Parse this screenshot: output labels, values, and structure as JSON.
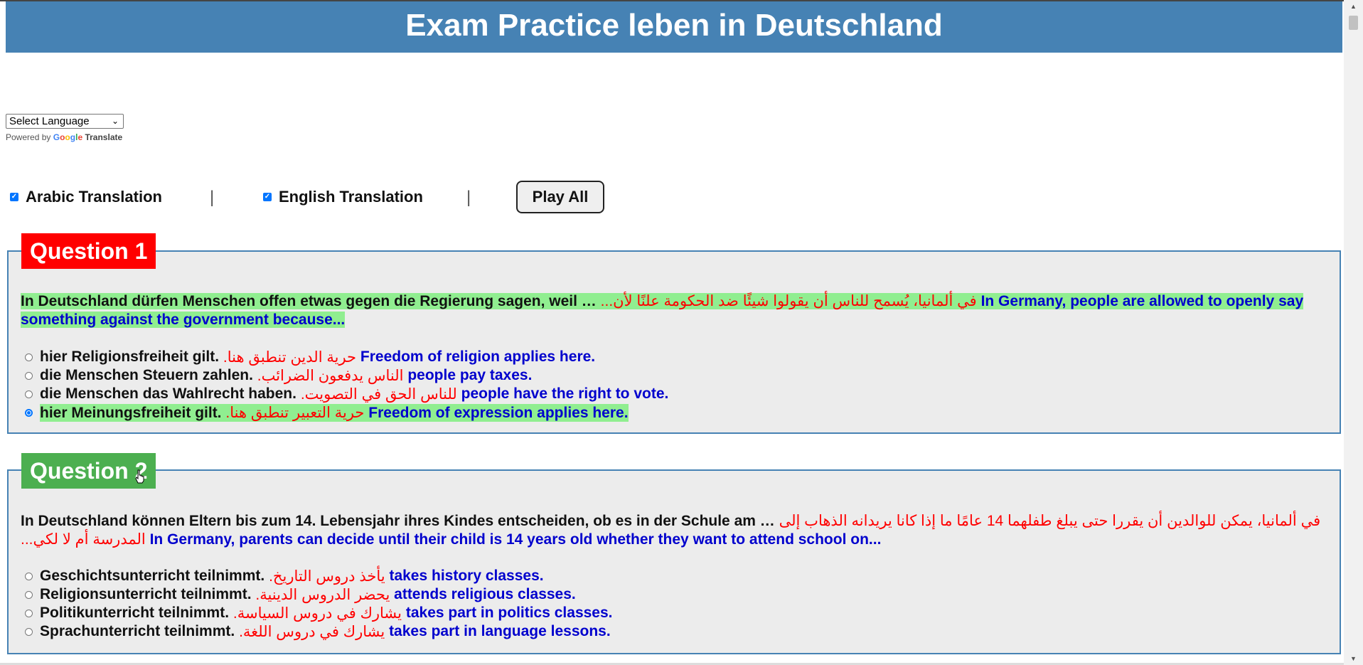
{
  "header": {
    "title": "Exam Practice leben in Deutschland"
  },
  "language": {
    "selected": "Select Language",
    "powered_by": "Powered by",
    "google": [
      "G",
      "o",
      "o",
      "g",
      "l",
      "e"
    ],
    "translate": "Translate"
  },
  "toggles": {
    "arabic": {
      "label": "Arabic Translation",
      "checked": true
    },
    "english": {
      "label": "English Translation",
      "checked": true
    },
    "separator": "|",
    "play_all": "Play All"
  },
  "colors": {
    "header": "#4682b4",
    "question_1_badge": "#ff0000",
    "question_2_badge": "#4caf50",
    "highlight": "#90ee90",
    "arabic": "#ff0000",
    "english": "#0000cd"
  },
  "questions": [
    {
      "label": "Question 1",
      "de": "In Deutschland dürfen Menschen offen etwas gegen die Regierung sagen, weil …",
      "ar": "في ألمانيا، يُسمح للناس أن يقولوا شيئًا ضد الحكومة علنًا لأن...",
      "en": "In Germany, people are allowed to openly say something against the government because...",
      "options": [
        {
          "de": "hier Religionsfreiheit gilt.",
          "ar": "حرية الدين تنطبق هنا.",
          "en": "Freedom of religion applies here.",
          "selected": false
        },
        {
          "de": "die Menschen Steuern zahlen.",
          "ar": "الناس يدفعون الضرائب.",
          "en": "people pay taxes.",
          "selected": false
        },
        {
          "de": "die Menschen das Wahlrecht haben.",
          "ar": "للناس الحق في التصويت.",
          "en": "people have the right to vote.",
          "selected": false
        },
        {
          "de": "hier Meinungsfreiheit gilt.",
          "ar": "حرية التعبير تنطبق هنا.",
          "en": "Freedom of expression applies here.",
          "selected": true
        }
      ]
    },
    {
      "label": "Question 2",
      "de": "In Deutschland können Eltern bis zum 14. Lebensjahr ihres Kindes entscheiden, ob es in der Schule am …",
      "ar": "في ألمانيا، يمكن للوالدين أن يقررا حتى يبلغ طفلهما 14 عامًا ما إذا كانا يريدانه الذهاب إلى المدرسة أم لا لكي...",
      "en": "In Germany, parents can decide until their child is 14 years old whether they want to attend school on...",
      "options": [
        {
          "de": "Geschichtsunterricht teilnimmt.",
          "ar": "يأخذ دروس التاريخ.",
          "en": "takes history classes.",
          "selected": false
        },
        {
          "de": "Religionsunterricht teilnimmt.",
          "ar": "يحضر الدروس الدينية.",
          "en": "attends religious classes.",
          "selected": false
        },
        {
          "de": "Politikunterricht teilnimmt.",
          "ar": "يشارك في دروس السياسة.",
          "en": "takes part in politics classes.",
          "selected": false
        },
        {
          "de": "Sprachunterricht teilnimmt.",
          "ar": "يشارك في دروس اللغة.",
          "en": "takes part in language lessons.",
          "selected": false
        }
      ]
    }
  ]
}
